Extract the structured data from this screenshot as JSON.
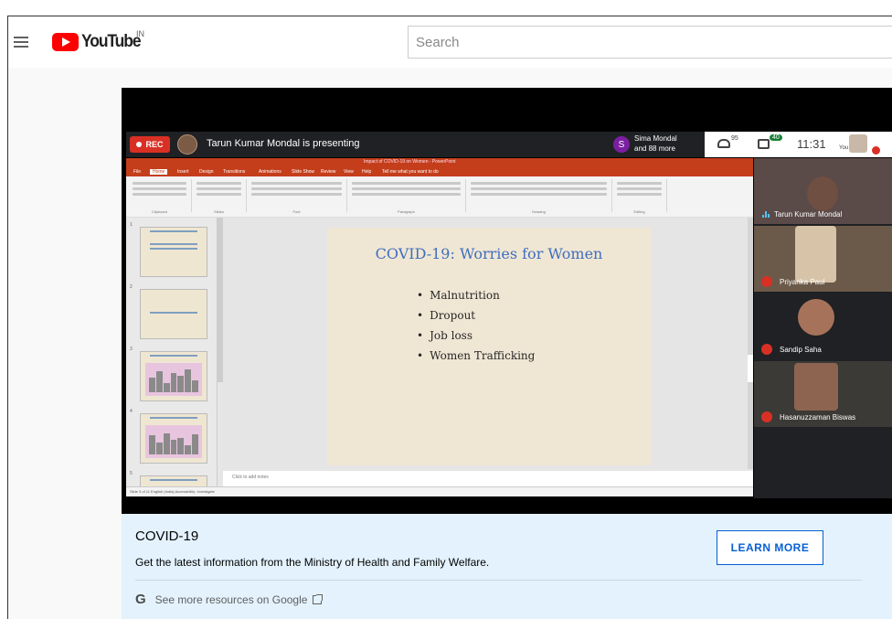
{
  "header": {
    "logo_text": "YouTube",
    "country_code": "IN",
    "search_placeholder": "Search"
  },
  "meet": {
    "rec_label": "REC",
    "presenter_text": "Tarun Kumar Mondal is presenting",
    "viewer_avatar_letter": "S",
    "viewer_name": "Sima Mondal",
    "viewer_more": "and 88 more",
    "people_count": "95",
    "chat_count": "40",
    "time": "11:31",
    "you_label": "You"
  },
  "ppt": {
    "window_title": "Impact of COVID-19 on Women - PowerPoint",
    "tabs": [
      "File",
      "Home",
      "Insert",
      "Design",
      "Transitions",
      "Animations",
      "Slide Show",
      "Review",
      "View",
      "Help",
      "Tell me what you want to do"
    ],
    "ribbon_groups": [
      "Clipboard",
      "Slides",
      "Font",
      "Paragraph",
      "Drawing",
      "Editing"
    ],
    "slide_title": "COVID-19: Worries for Women",
    "bullets": [
      "Malnutrition",
      "Dropout",
      "Job loss",
      "Women Trafficking"
    ],
    "notes_placeholder": "Click to add notes",
    "status_text": "Slide 3 of 11    English (India)    Accessibility: Investigate"
  },
  "participants": [
    {
      "name": "Tarun Kumar Mondal",
      "speaking": true
    },
    {
      "name": "Priyanka Paul",
      "speaking": false
    },
    {
      "name": "Sandip Saha",
      "speaking": false
    },
    {
      "name": "Hasanuzzaman Biswas",
      "speaking": false
    }
  ],
  "info_panel": {
    "title": "COVID-19",
    "description": "Get the latest information from the Ministry of Health and Family Welfare.",
    "button_label": "LEARN MORE",
    "more_link": "See more resources on Google"
  }
}
